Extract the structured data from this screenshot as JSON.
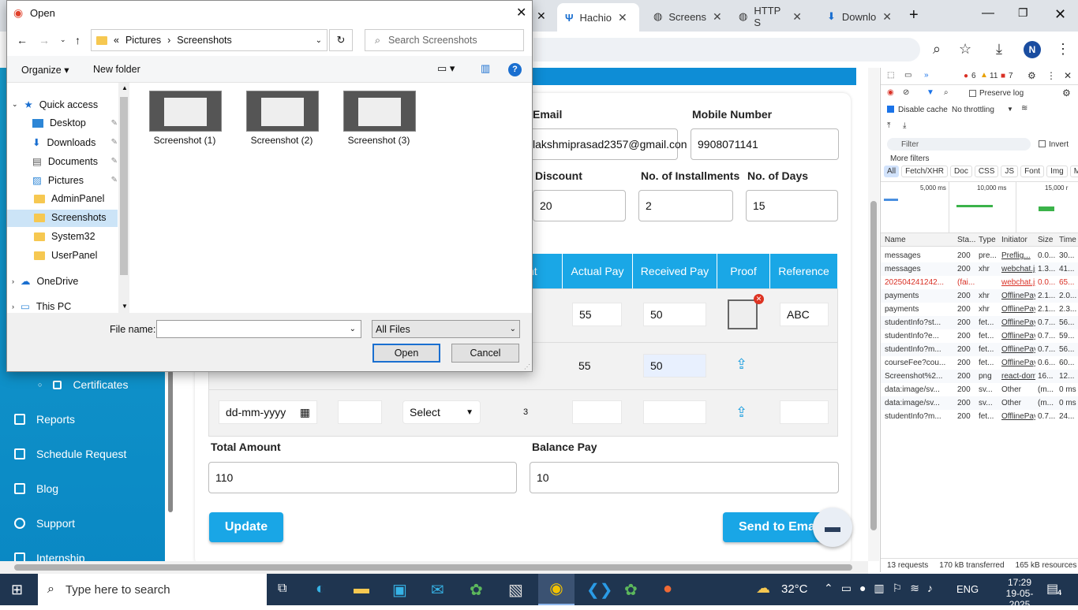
{
  "browser": {
    "tabs": [
      {
        "label": "Hachio",
        "active": true
      },
      {
        "label": "Screens"
      },
      {
        "label": "HTTP S"
      },
      {
        "label": "Downlo"
      }
    ],
    "avatar": "N"
  },
  "sidebar": {
    "items": [
      {
        "label": "Certificates",
        "icon": "certificate-icon"
      },
      {
        "label": "Reports",
        "icon": "reports-icon"
      },
      {
        "label": "Schedule Request",
        "icon": "schedule-icon"
      },
      {
        "label": "Blog",
        "icon": "blog-icon"
      },
      {
        "label": "Support",
        "icon": "support-icon"
      },
      {
        "label": "Internship",
        "icon": "internship-icon"
      }
    ]
  },
  "form": {
    "email_label": "Email",
    "email_value": "lakshmiprasad2357@gmail.con",
    "mobile_label": "Mobile Number",
    "mobile_value": "9908071141",
    "discount_label": "Discount",
    "discount_value": "20",
    "installments_label": "No. of Installments",
    "installments_value": "2",
    "days_label": "No. of Days",
    "days_value": "15",
    "table_headers": [
      "nent",
      "Actual Pay",
      "Received Pay",
      "Proof",
      "Reference"
    ],
    "rows": [
      {
        "actual": "55",
        "received": "50",
        "reference": "ABC"
      },
      {
        "actual": "55",
        "received": "50",
        "reference": ""
      }
    ],
    "new_row": {
      "date_placeholder": "dd-mm-yyyy",
      "select": "Select",
      "installment_no": "3"
    },
    "total_label": "Total Amount",
    "total_value": "110",
    "balance_label": "Balance Pay",
    "balance_value": "10",
    "update_button": "Update",
    "send_button": "Send to Ema"
  },
  "devtools": {
    "errors": "6",
    "warnings": "11",
    "issues": "7",
    "preserve_log": "Preserve log",
    "disable_cache": "Disable cache",
    "throttling": "No throttling",
    "filter_placeholder": "Filter",
    "invert": "Invert",
    "more_filters": "More filters",
    "type_filters": [
      "All",
      "Fetch/XHR",
      "Doc",
      "CSS",
      "JS",
      "Font",
      "Img",
      "Media"
    ],
    "timeline": [
      "5,000 ms",
      "10,000 ms",
      "15,000 r"
    ],
    "columns": [
      "Name",
      "Sta...",
      "Type",
      "Initiator",
      "Size",
      "Time"
    ],
    "requests": [
      [
        "messages",
        "200",
        "pre...",
        "Preflig...",
        "0.0...",
        "30..."
      ],
      [
        "messages",
        "200",
        "xhr",
        "webchat.js",
        "1.3...",
        "41..."
      ],
      [
        "202504241242...",
        "(fai...",
        "",
        "webchat.js",
        "0.0...",
        "65..."
      ],
      [
        "payments",
        "200",
        "xhr",
        "OfflinePay",
        "2.1...",
        "2.0..."
      ],
      [
        "payments",
        "200",
        "xhr",
        "OfflinePay",
        "2.1...",
        "2.3..."
      ],
      [
        "studentInfo?st...",
        "200",
        "fet...",
        "OfflinePay",
        "0.7...",
        "56..."
      ],
      [
        "studentInfo?e...",
        "200",
        "fet...",
        "OfflinePay",
        "0.7...",
        "59..."
      ],
      [
        "studentInfo?m...",
        "200",
        "fet...",
        "OfflinePay",
        "0.7...",
        "56..."
      ],
      [
        "courseFee?cou...",
        "200",
        "fet...",
        "OfflinePay",
        "0.6...",
        "60..."
      ],
      [
        "Screenshot%2...",
        "200",
        "png",
        "react-dom",
        "16...",
        "12..."
      ],
      [
        "data:image/sv...",
        "200",
        "sv...",
        "Other",
        "(m...",
        "0 ms"
      ],
      [
        "data:image/sv...",
        "200",
        "sv...",
        "Other",
        "(m...",
        "0 ms"
      ],
      [
        "studentInfo?m...",
        "200",
        "fet...",
        "OfflinePay",
        "0.7...",
        "24..."
      ]
    ],
    "status": {
      "requests": "13 requests",
      "transferred": "170 kB transferred",
      "resources": "165 kB resources"
    }
  },
  "dialog": {
    "title": "Open",
    "breadcrumb": [
      "Pictures",
      "Screenshots"
    ],
    "search_placeholder": "Search Screenshots",
    "organize": "Organize",
    "new_folder": "New folder",
    "nav": [
      {
        "label": "Quick access",
        "icon": "star-icon"
      },
      {
        "label": "Desktop",
        "icon": "desktop-icon",
        "pinned": true
      },
      {
        "label": "Downloads",
        "icon": "download-icon",
        "pinned": true
      },
      {
        "label": "Documents",
        "icon": "document-icon",
        "pinned": true
      },
      {
        "label": "Pictures",
        "icon": "pictures-icon",
        "pinned": true
      },
      {
        "label": "AdminPanel",
        "icon": "folder-icon"
      },
      {
        "label": "Screenshots",
        "icon": "folder-icon",
        "selected": true
      },
      {
        "label": "System32",
        "icon": "folder-icon"
      },
      {
        "label": "UserPanel",
        "icon": "folder-icon"
      },
      {
        "label": "OneDrive",
        "icon": "cloud-icon"
      },
      {
        "label": "This PC",
        "icon": "pc-icon"
      }
    ],
    "files": [
      "Screenshot (1)",
      "Screenshot (2)",
      "Screenshot (3)"
    ],
    "file_name_label": "File name:",
    "file_name_value": "",
    "file_type": "All Files",
    "open_button": "Open",
    "cancel_button": "Cancel"
  },
  "taskbar": {
    "search_placeholder": "Type here to search",
    "temperature": "32°C",
    "language": "ENG",
    "time": "17:29",
    "date": "19-05-2025",
    "notifications": "4"
  }
}
